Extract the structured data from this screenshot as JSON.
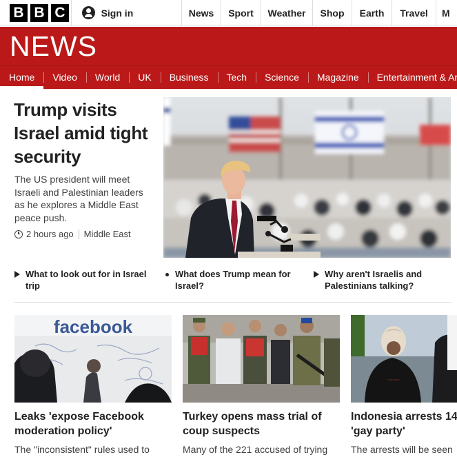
{
  "brand": {
    "letters": [
      "B",
      "B",
      "C"
    ],
    "section": "NEWS",
    "accent": "#bb1919"
  },
  "signin": {
    "label": "Sign in",
    "icon": "user-icon"
  },
  "topnav": [
    "News",
    "Sport",
    "Weather",
    "Shop",
    "Earth",
    "Travel",
    "M"
  ],
  "secnav": {
    "active": "Home",
    "tabs": [
      "Home",
      "Video",
      "World",
      "UK",
      "Business",
      "Tech",
      "Science",
      "Magazine",
      "Entertainment & Arts"
    ]
  },
  "lead": {
    "title": "Trump visits Israel amid tight security",
    "summary": "The US president will meet Israeli and Palestinian leaders as he explores a Middle East peace push.",
    "time": "2 hours ago",
    "tag": "Middle East"
  },
  "related": [
    {
      "icon": "play-icon",
      "text": "What to look out for in Israel trip"
    },
    {
      "icon": "bullet-icon",
      "text": "What does Trump mean for Israel?"
    },
    {
      "icon": "play-icon",
      "text": "Why aren't Israelis and Palestinians talking?"
    }
  ],
  "stories": [
    {
      "title_line1": "Leaks 'expose Facebook",
      "title_line2": "moderation policy'",
      "summary": "The \"inconsistent\" rules used to",
      "image_text": "facebook"
    },
    {
      "title_line1": "Turkey opens mass trial of",
      "title_line2": "coup suspects",
      "summary": "Many of the 221 accused of trying"
    },
    {
      "title_line1": "Indonesia arrests 14",
      "title_line2": "'gay party'",
      "summary": "The arrests will be seen"
    }
  ]
}
